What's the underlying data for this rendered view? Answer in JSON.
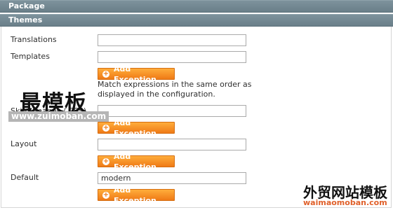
{
  "sections": {
    "package_title": "Package",
    "themes_title": "Themes"
  },
  "fields": [
    {
      "label": "Translations",
      "value": "",
      "has_button": false
    },
    {
      "label": "Templates",
      "value": "",
      "has_button": true
    },
    {
      "label": "Skin (Images / CSS)",
      "value": "",
      "has_button": true
    },
    {
      "label": "Layout",
      "value": "",
      "has_button": true
    },
    {
      "label": "Default",
      "value": "modern",
      "has_button": true
    }
  ],
  "button_label": "Add Exception",
  "note": "Match expressions in the same order as displayed in the configuration.",
  "watermarks": {
    "main": "最模板",
    "sub": "www.zuimoban.com",
    "right": "外贸网站模板",
    "right_sub": "waimaomoban.com"
  },
  "colors": {
    "header_bg": "#6a7f89",
    "button_bg": "#ef7a16"
  }
}
